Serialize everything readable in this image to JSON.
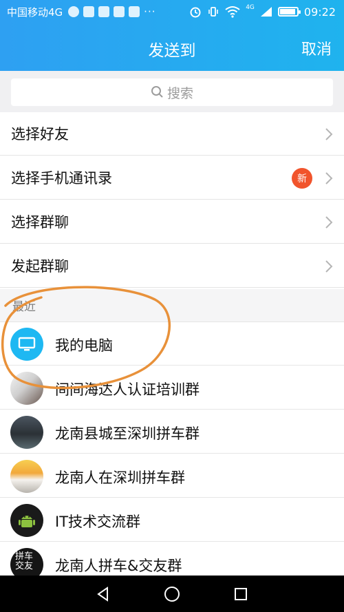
{
  "status_bar": {
    "carrier": "中国移动4G",
    "dots": "···",
    "network": "4G",
    "time": "09:22"
  },
  "header": {
    "title": "发送到",
    "cancel_label": "取消"
  },
  "search": {
    "placeholder": "搜索"
  },
  "menu": [
    {
      "label": "选择好友"
    },
    {
      "label": "选择手机通讯录",
      "badge": "新"
    },
    {
      "label": "选择群聊"
    },
    {
      "label": "发起群聊"
    }
  ],
  "recent": {
    "label": "最近",
    "items": [
      {
        "name": "我的电脑",
        "icon": "computer-icon"
      },
      {
        "name": "间间海达人认证培训群"
      },
      {
        "name": "龙南县城至深圳拼车群"
      },
      {
        "name": "龙南人在深圳拼车群"
      },
      {
        "name": "IT技术交流群",
        "icon": "android-icon"
      },
      {
        "name": "龙南人拼车&交友群",
        "avatar_text": "拼车 交友"
      }
    ]
  },
  "colors": {
    "header": "#2ea0f2",
    "badge": "#f1542c",
    "annotation": "#e8913a"
  }
}
